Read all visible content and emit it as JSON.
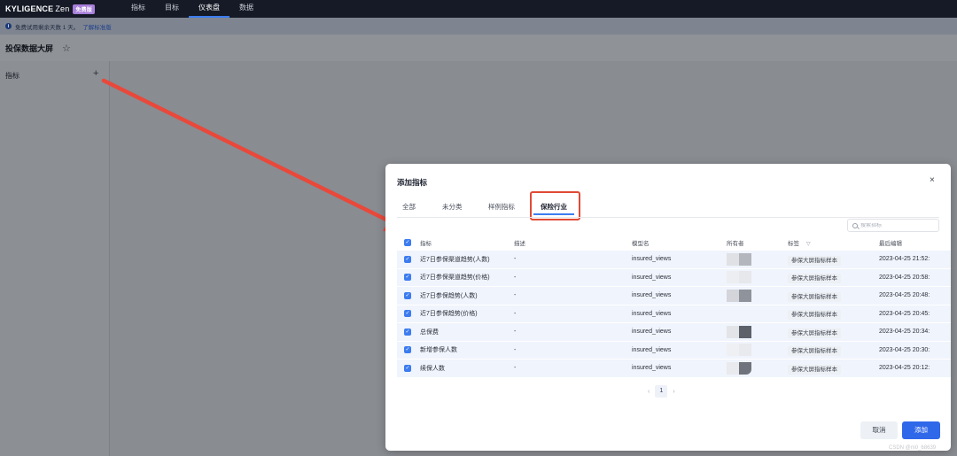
{
  "topbar": {
    "logo": "KYLIGENCE",
    "logo_suffix": "Zen",
    "plan_badge": "免费版",
    "nav": [
      {
        "label": "指标",
        "active": false
      },
      {
        "label": "目标",
        "active": false
      },
      {
        "label": "仪表盘",
        "active": true
      },
      {
        "label": "数据",
        "active": false
      }
    ]
  },
  "notice": {
    "text": "免费试用剩余天数 1 天。",
    "link": "了解标准版"
  },
  "page": {
    "title": "投保数据大屏"
  },
  "sidebar": {
    "label": "指标",
    "add": "+"
  },
  "modal": {
    "title": "添加指标",
    "close": "×",
    "tabs": [
      {
        "label": "全部"
      },
      {
        "label": "未分类"
      },
      {
        "label": "样例指标"
      },
      {
        "label": "保险行业",
        "active": true
      }
    ],
    "search_placeholder": "搜索指标",
    "columns": {
      "name": "指标",
      "desc": "描述",
      "model": "模型名",
      "owner": "所有者",
      "tag": "标签",
      "edited": "最后编辑"
    },
    "rows": [
      {
        "name": "近7日参保渠道趋势(人数)",
        "desc": "-",
        "model": "insured_views",
        "tag": "参保大屏指标样本",
        "edited": "2023-04-25 21:52:"
      },
      {
        "name": "近7日参保渠道趋势(价格)",
        "desc": "-",
        "model": "insured_views",
        "tag": "参保大屏指标样本",
        "edited": "2023-04-25 20:58:"
      },
      {
        "name": "近7日参保趋势(人数)",
        "desc": "-",
        "model": "insured_views",
        "tag": "参保大屏指标样本",
        "edited": "2023-04-25 20:48:"
      },
      {
        "name": "近7日参保趋势(价格)",
        "desc": "-",
        "model": "insured_views",
        "tag": "参保大屏指标样本",
        "edited": "2023-04-25 20:45:"
      },
      {
        "name": "总保费",
        "desc": "-",
        "model": "insured_views",
        "tag": "参保大屏指标样本",
        "edited": "2023-04-25 20:34:"
      },
      {
        "name": "新增参保人数",
        "desc": "-",
        "model": "insured_views",
        "tag": "参保大屏指标样本",
        "edited": "2023-04-25 20:30:"
      },
      {
        "name": "续保人数",
        "desc": "-",
        "model": "insured_views",
        "tag": "参保大屏指标样本",
        "edited": "2023-04-25 20:12:"
      }
    ],
    "pagination": {
      "prev": "‹",
      "current": "1",
      "next": "›"
    },
    "cancel": "取消",
    "add": "添加"
  },
  "colors": {
    "accent": "#3068ea",
    "highlight": "#e04a35",
    "arrow": "#e9483a"
  },
  "watermark": "CSDN @m0_68639"
}
